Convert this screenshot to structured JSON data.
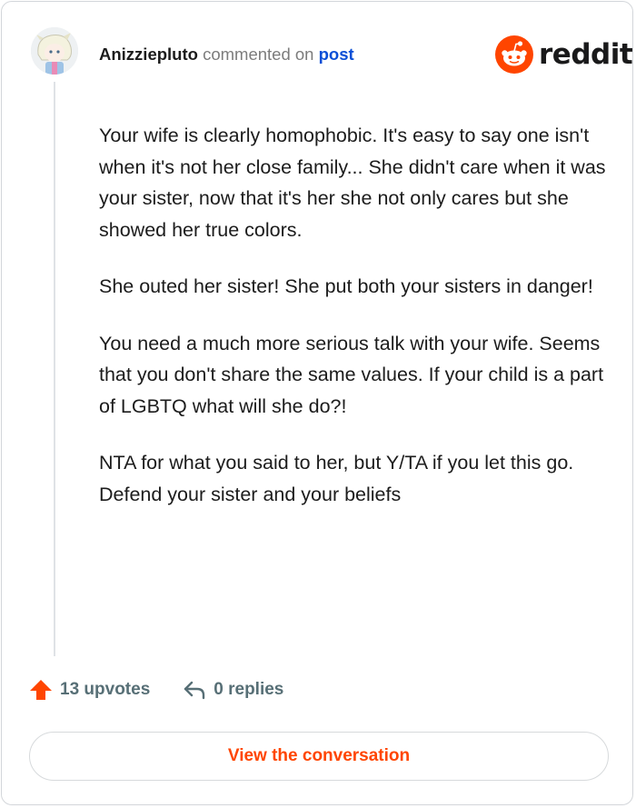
{
  "header": {
    "username": "Anizziepluto",
    "action_text": " commented on ",
    "post_link": "post"
  },
  "logo": {
    "wordmark": "reddit",
    "icon": "reddit-snoo-icon",
    "brand_color": "#ff4500"
  },
  "comment": {
    "paragraphs": [
      "Your wife is clearly homophobic. It's easy to say one isn't when it's not her close family... She didn't care when it was your sister, now that it's her she not only cares but she showed her true colors.",
      "She outed her sister! She put both your sisters in danger!",
      "You need a much more serious talk with your wife. Seems that you don't share the same values. If your child is a part of LGBTQ what will she do?!",
      "NTA for what you said to her, but Y/TA if you let this go. Defend your sister and your beliefs"
    ]
  },
  "actions": {
    "upvotes": "13 upvotes",
    "replies": "0 replies"
  },
  "cta": {
    "label": "View the conversation"
  },
  "colors": {
    "accent": "#ff4500",
    "link": "#0a4fd6",
    "muted": "#576f76"
  }
}
